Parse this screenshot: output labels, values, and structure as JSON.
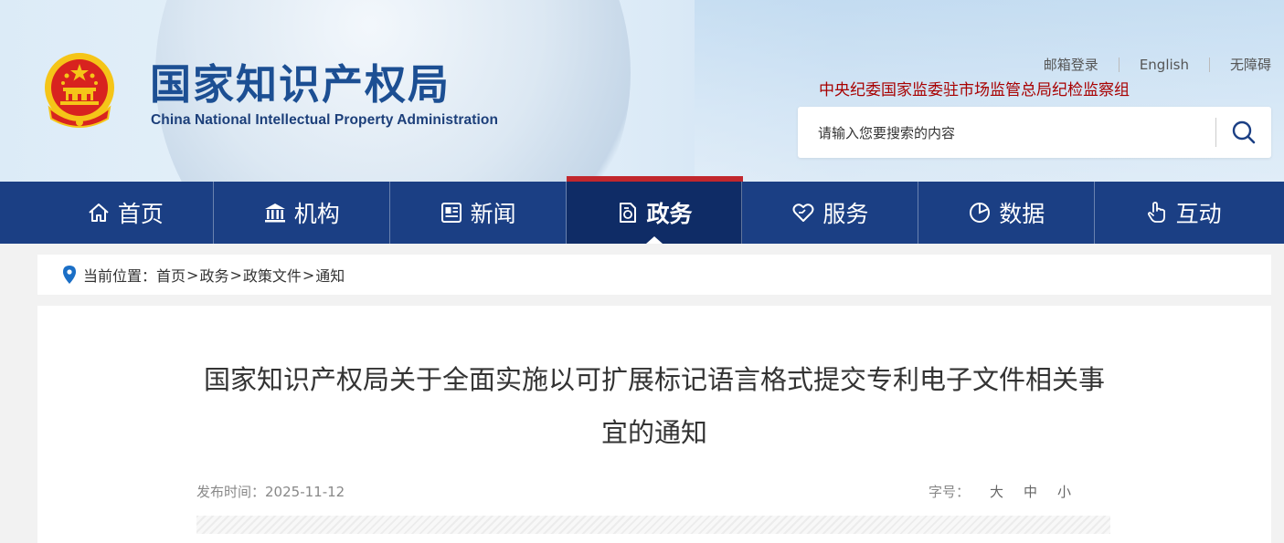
{
  "header": {
    "site_title": "国家知识产权局",
    "site_subtitle": "China National Intellectual Property Administration",
    "top_links": [
      "邮箱登录",
      "English",
      "无障碍"
    ],
    "discipline_link": "中央纪委国家监委驻市场监管总局纪检监察组",
    "search": {
      "placeholder": "请输入您要搜索的内容"
    }
  },
  "nav": {
    "items": [
      {
        "label": "首页",
        "icon": "home-icon"
      },
      {
        "label": "机构",
        "icon": "institution-icon"
      },
      {
        "label": "新闻",
        "icon": "news-icon"
      },
      {
        "label": "政务",
        "icon": "government-affairs-icon",
        "active": true
      },
      {
        "label": "服务",
        "icon": "service-icon"
      },
      {
        "label": "数据",
        "icon": "data-pie-icon"
      },
      {
        "label": "互动",
        "icon": "interaction-hand-icon"
      }
    ]
  },
  "breadcrumb": {
    "prefix": "当前位置：",
    "items": [
      "首页",
      "政务",
      "政策文件",
      "通知"
    ],
    "separator": ">"
  },
  "article": {
    "title": "国家知识产权局关于全面实施以可扩展标记语言格式提交专利电子文件相关事宜的通知",
    "date_label": "发布时间：",
    "date": "2025-11-12",
    "font_size_label": "字号：",
    "font_sizes": [
      "大",
      "中",
      "小"
    ]
  },
  "colors": {
    "nav_bg": "#1b3f84",
    "nav_active_bg": "#0f2c66",
    "nav_active_bar": "#c1272d",
    "title_blue": "#1c4f93",
    "discipline_red": "#a80000"
  }
}
